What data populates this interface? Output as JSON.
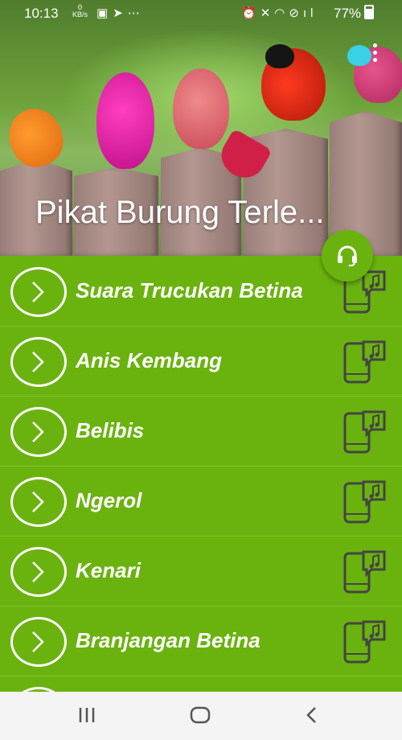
{
  "status_bar": {
    "time": "10:13",
    "kb_value": "0",
    "kb_unit": "KB/s",
    "battery": "77%"
  },
  "header": {
    "title": "Pikat Burung Terle..."
  },
  "list": {
    "items": [
      {
        "label": "Suara Trucukan Betina"
      },
      {
        "label": "Anis Kembang"
      },
      {
        "label": "Belibis"
      },
      {
        "label": "Ngerol"
      },
      {
        "label": "Kenari"
      },
      {
        "label": "Branjangan Betina"
      }
    ]
  },
  "colors": {
    "accent": "#6ab30e",
    "icon_dark": "#444444"
  },
  "icons": {
    "fab": "headset-icon",
    "row_left": "chevron-right-icon",
    "row_right": "phone-music-icon"
  }
}
